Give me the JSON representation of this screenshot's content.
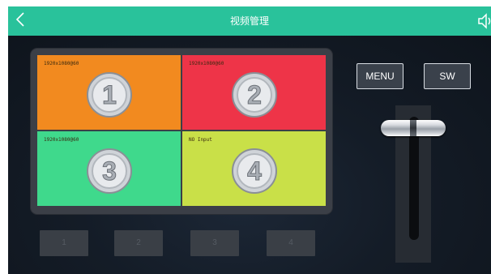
{
  "header": {
    "title": "视频管理",
    "back_icon": "chevron-left-icon",
    "volume_icon": "speaker-icon"
  },
  "colors": {
    "header": "#29c29b",
    "background": "#111821",
    "input1": "#f28a1f",
    "input2": "#ee3448",
    "input3": "#3fd98c",
    "input4": "#c9e048"
  },
  "preview": {
    "cells": [
      {
        "number": "1",
        "label": "1920x1080@60"
      },
      {
        "number": "2",
        "label": "1920x1080@60"
      },
      {
        "number": "3",
        "label": "1920x1080@60"
      },
      {
        "number": "4",
        "label": "NO Input"
      }
    ]
  },
  "controls": {
    "menu_label": "MENU",
    "sw_label": "SW"
  },
  "channels": [
    "1",
    "2",
    "3",
    "4"
  ],
  "fader": {
    "level": 0.85
  }
}
